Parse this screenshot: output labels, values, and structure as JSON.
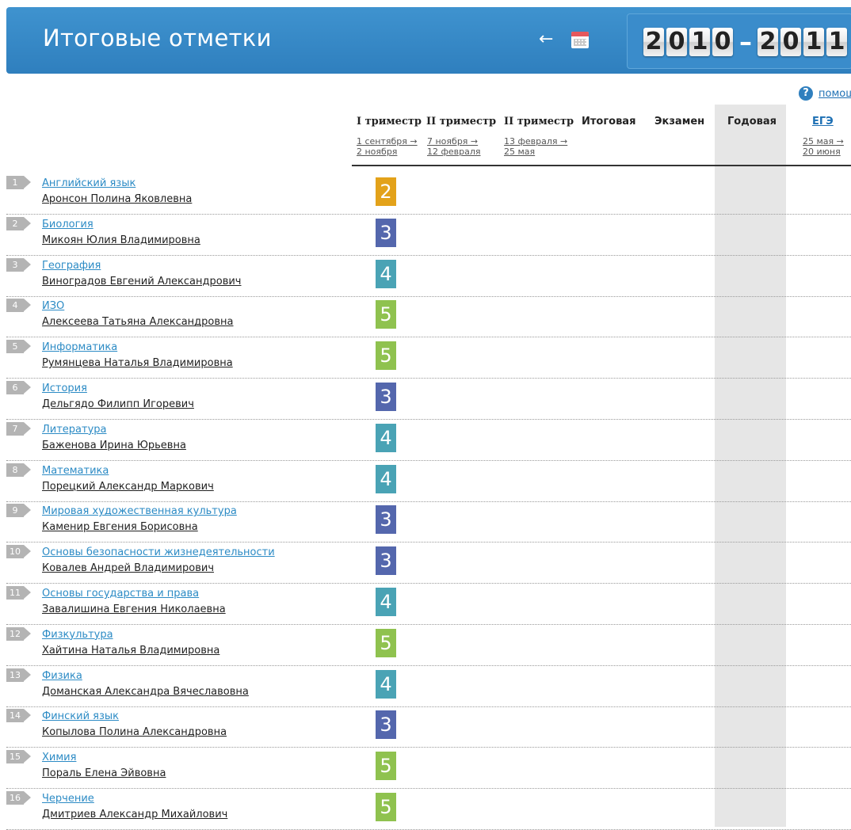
{
  "header": {
    "title": "Итоговые отметки",
    "back_arrow": "←",
    "calendar_icon": "calendar-icon",
    "year_start_digits": [
      "2",
      "0",
      "1",
      "0"
    ],
    "year_dash": "–",
    "year_end_digits": [
      "2",
      "0",
      "1",
      "1"
    ]
  },
  "help": {
    "icon": "?",
    "label": "помощ"
  },
  "columns": [
    {
      "label": "I триместр",
      "dates": [
        "1 сентября →",
        "2 ноября"
      ]
    },
    {
      "label": "II триместр",
      "dates": [
        "7 ноября →",
        "12 февраля"
      ]
    },
    {
      "label": "II триместр",
      "dates": [
        "13 февраля →",
        "25 мая"
      ]
    },
    {
      "label": "Итоговая",
      "dates": []
    },
    {
      "label": "Экзамен",
      "dates": []
    },
    {
      "label": "Годовая",
      "dates": []
    },
    {
      "label": "ЕГЭ",
      "dates": [
        "25 мая →",
        "20 июня"
      ]
    }
  ],
  "grade_colors": {
    "2": "#e3a21a",
    "3": "#5467ad",
    "4": "#4aa3b5",
    "5": "#8fc24f"
  },
  "rows": [
    {
      "n": "1",
      "subject": "Английский язык",
      "teacher": "Аронсон Полина Яковлевна",
      "grade": "2"
    },
    {
      "n": "2",
      "subject": "Биология",
      "teacher": "Микоян Юлия Владимировна",
      "grade": "3"
    },
    {
      "n": "3",
      "subject": "География",
      "teacher": "Виноградов Евгений Александрович",
      "grade": "4"
    },
    {
      "n": "4",
      "subject": "ИЗО",
      "teacher": "Алексеева Татьяна Александровна",
      "grade": "5"
    },
    {
      "n": "5",
      "subject": "Информатика",
      "teacher": "Румянцева Наталья Владимировна",
      "grade": "5"
    },
    {
      "n": "6",
      "subject": "История",
      "teacher": "Дельгядо Филипп Игоревич",
      "grade": "3"
    },
    {
      "n": "7",
      "subject": "Литература",
      "teacher": "Баженова Ирина Юрьевна",
      "grade": "4"
    },
    {
      "n": "8",
      "subject": "Математика",
      "teacher": "Порецкий Александр Маркович",
      "grade": "4"
    },
    {
      "n": "9",
      "subject": "Мировая художественная культура",
      "teacher": "Каменир Евгения Борисовна",
      "grade": "3"
    },
    {
      "n": "10",
      "subject": "Основы безопасности жизнедеятельности",
      "teacher": "Ковалев Андрей Владимирович",
      "grade": "3"
    },
    {
      "n": "11",
      "subject": "Основы государства и права",
      "teacher": "Завалишина Евгения Николаевна",
      "grade": "4"
    },
    {
      "n": "12",
      "subject": "Физкультура",
      "teacher": "Хайтина Наталья Владимировна",
      "grade": "5"
    },
    {
      "n": "13",
      "subject": "Физика",
      "teacher": "Доманская Александра Вячеславовна",
      "grade": "4"
    },
    {
      "n": "14",
      "subject": "Финский язык",
      "teacher": "Копылова Полина Александровна",
      "grade": "3"
    },
    {
      "n": "15",
      "subject": "Химия",
      "teacher": "Пораль Елена Эйвовна",
      "grade": "5"
    },
    {
      "n": "16",
      "subject": "Черчение",
      "teacher": "Дмитриев Александр Михайлович",
      "grade": "5"
    }
  ]
}
